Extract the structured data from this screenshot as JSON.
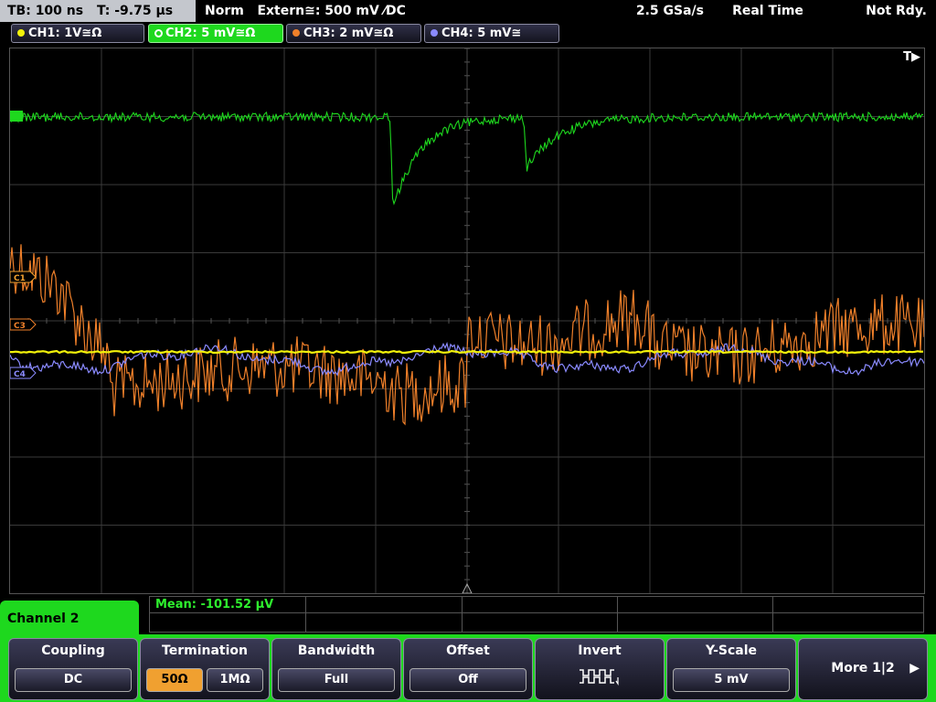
{
  "status": {
    "timebase": "TB: 100 ns",
    "trigger_time": "T: -9.75 µs",
    "trigger_mode": "Norm",
    "trigger_source": "Extern≅: 500 mV ⁄DC",
    "sample_rate": "2.5 GSa/s",
    "acquisition": "Real Time",
    "run_state": "Not Rdy."
  },
  "channels": [
    {
      "label": "CH1: 1V≅Ω",
      "color": "#f2f20a",
      "active": false
    },
    {
      "label": "CH2: 5 mV≅Ω",
      "color": "#1ed81e",
      "active": true
    },
    {
      "label": "CH3: 2 mV≅Ω",
      "color": "#f0802a",
      "active": false
    },
    {
      "label": "CH4: 5 mV≅",
      "color": "#8a8aff",
      "active": false
    }
  ],
  "trace_markers": {
    "c1": "C1",
    "c3": "C3",
    "c4": "C4",
    "trigger": "T▶"
  },
  "measurement": {
    "text": "Mean: -101.52 µV"
  },
  "panel": {
    "channel_title": "Channel 2",
    "coupling": {
      "title": "Coupling",
      "value": "DC"
    },
    "termination": {
      "title": "Termination",
      "options": [
        "50Ω",
        "1MΩ"
      ],
      "selected": "50Ω"
    },
    "bandwidth": {
      "title": "Bandwidth",
      "value": "Full"
    },
    "offset": {
      "title": "Offset",
      "value": "Off"
    },
    "invert": {
      "title": "Invert"
    },
    "yscale": {
      "title": "Y-Scale",
      "value": "5 mV"
    },
    "more": {
      "label": "More 1|2",
      "arrow": "▶"
    }
  }
}
